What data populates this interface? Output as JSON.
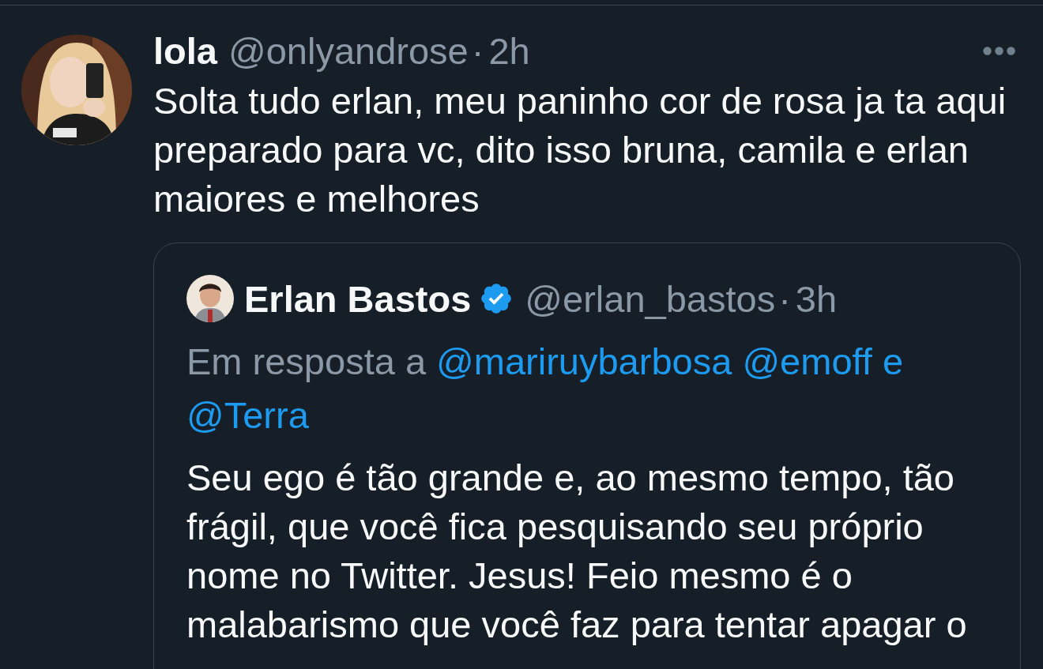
{
  "tweet": {
    "name": "lola",
    "handle": "@onlyandrose",
    "separator": "·",
    "time": "2h",
    "text": "Solta tudo erlan, meu paninho cor de rosa ja ta aqui preparado para vc, dito isso bruna, camila e erlan maiores e melhores",
    "quoted": {
      "name": "Erlan Bastos",
      "verified": true,
      "handle": "@erlan_bastos",
      "separator": "·",
      "time": "3h",
      "reply_prefix": "Em resposta a",
      "reply_to": [
        "@mariruybarbosa",
        "@emoff"
      ],
      "reply_joiner": "e",
      "reply_last": "@Terra",
      "text": "Seu ego é tão grande e, ao mesmo tempo, tão frágil, que você fica pesquisando seu próprio nome no Twitter. Jesus! Feio mesmo é o malabarismo que você faz para tentar apagar o"
    }
  }
}
